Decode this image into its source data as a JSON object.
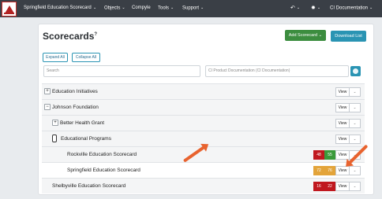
{
  "topbar": {
    "app_title": "Springfield Education Scorecard",
    "menu": [
      "Objects",
      "Compyle",
      "Tools",
      "Support"
    ],
    "user": "CI Documentation"
  },
  "page": {
    "title": "Scorecards",
    "help_mark": "?",
    "add_label": "Add Scorecard",
    "download_label": "Download List",
    "expand_label": "Expand All",
    "collapse_label": "Collapse All",
    "search_placeholder": "Search",
    "filter_value": "CI Product Documentation (CI Documentation)"
  },
  "rows": [
    {
      "label": "Education Initiatives",
      "toggle": "+",
      "view": "View"
    },
    {
      "label": "Johnson Foundation",
      "toggle": "−",
      "view": "View"
    },
    {
      "label": "Better Health Grant",
      "toggle": "+",
      "view": "View"
    },
    {
      "label": "Educational Programs",
      "view": "View"
    },
    {
      "label": "Rockville Education Scorecard",
      "view": "View",
      "scores": [
        "48",
        "55"
      ]
    },
    {
      "label": "Springfield Education Scorecard",
      "view": "View",
      "scores": [
        "72",
        "76"
      ]
    },
    {
      "label": "Shelbyville Education Scorecard",
      "view": "View",
      "scores": [
        "16",
        "22"
      ]
    }
  ],
  "colors": {
    "red": "#c0181f",
    "green": "#3a9a3a",
    "amber": "#e3a43a",
    "arrow": "#e8632f"
  }
}
